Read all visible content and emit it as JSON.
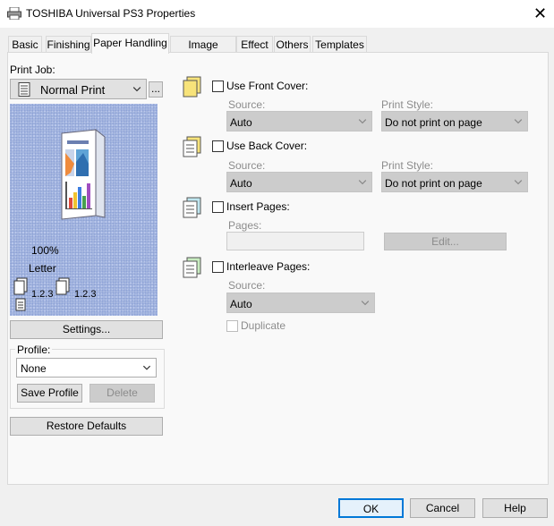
{
  "window": {
    "title": "TOSHIBA Universal PS3 Properties",
    "close": "✕"
  },
  "tabs": [
    "Basic",
    "Finishing",
    "Paper Handling",
    "Image Quality",
    "Effect",
    "Others",
    "Templates"
  ],
  "left": {
    "print_job_label": "Print Job:",
    "print_job_value": "Normal Print",
    "more_button": "...",
    "preview": {
      "zoom": "100%",
      "paper": "Letter",
      "order_1": "1.2.3",
      "order_2": "1.2.3"
    },
    "settings_button": "Settings...",
    "profile_label": "Profile:",
    "profile_value": "None",
    "save_profile_button": "Save Profile",
    "delete_button": "Delete",
    "restore_button": "Restore Defaults"
  },
  "front_cover": {
    "label": "Use Front Cover:",
    "source_label": "Source:",
    "source_value": "Auto",
    "style_label": "Print Style:",
    "style_value": "Do not print on page"
  },
  "back_cover": {
    "label": "Use Back Cover:",
    "source_label": "Source:",
    "source_value": "Auto",
    "style_label": "Print Style:",
    "style_value": "Do not print on page"
  },
  "insert_pages": {
    "label": "Insert Pages:",
    "pages_label": "Pages:",
    "edit_button": "Edit..."
  },
  "interleave": {
    "label": "Interleave Pages:",
    "source_label": "Source:",
    "source_value": "Auto",
    "duplicate_label": "Duplicate"
  },
  "footer": {
    "ok": "OK",
    "cancel": "Cancel",
    "help": "Help"
  },
  "colors": {
    "accent": "#0078d7",
    "preview_bg": "#a7b8e0",
    "cover_yellow": "#f7e37a"
  }
}
